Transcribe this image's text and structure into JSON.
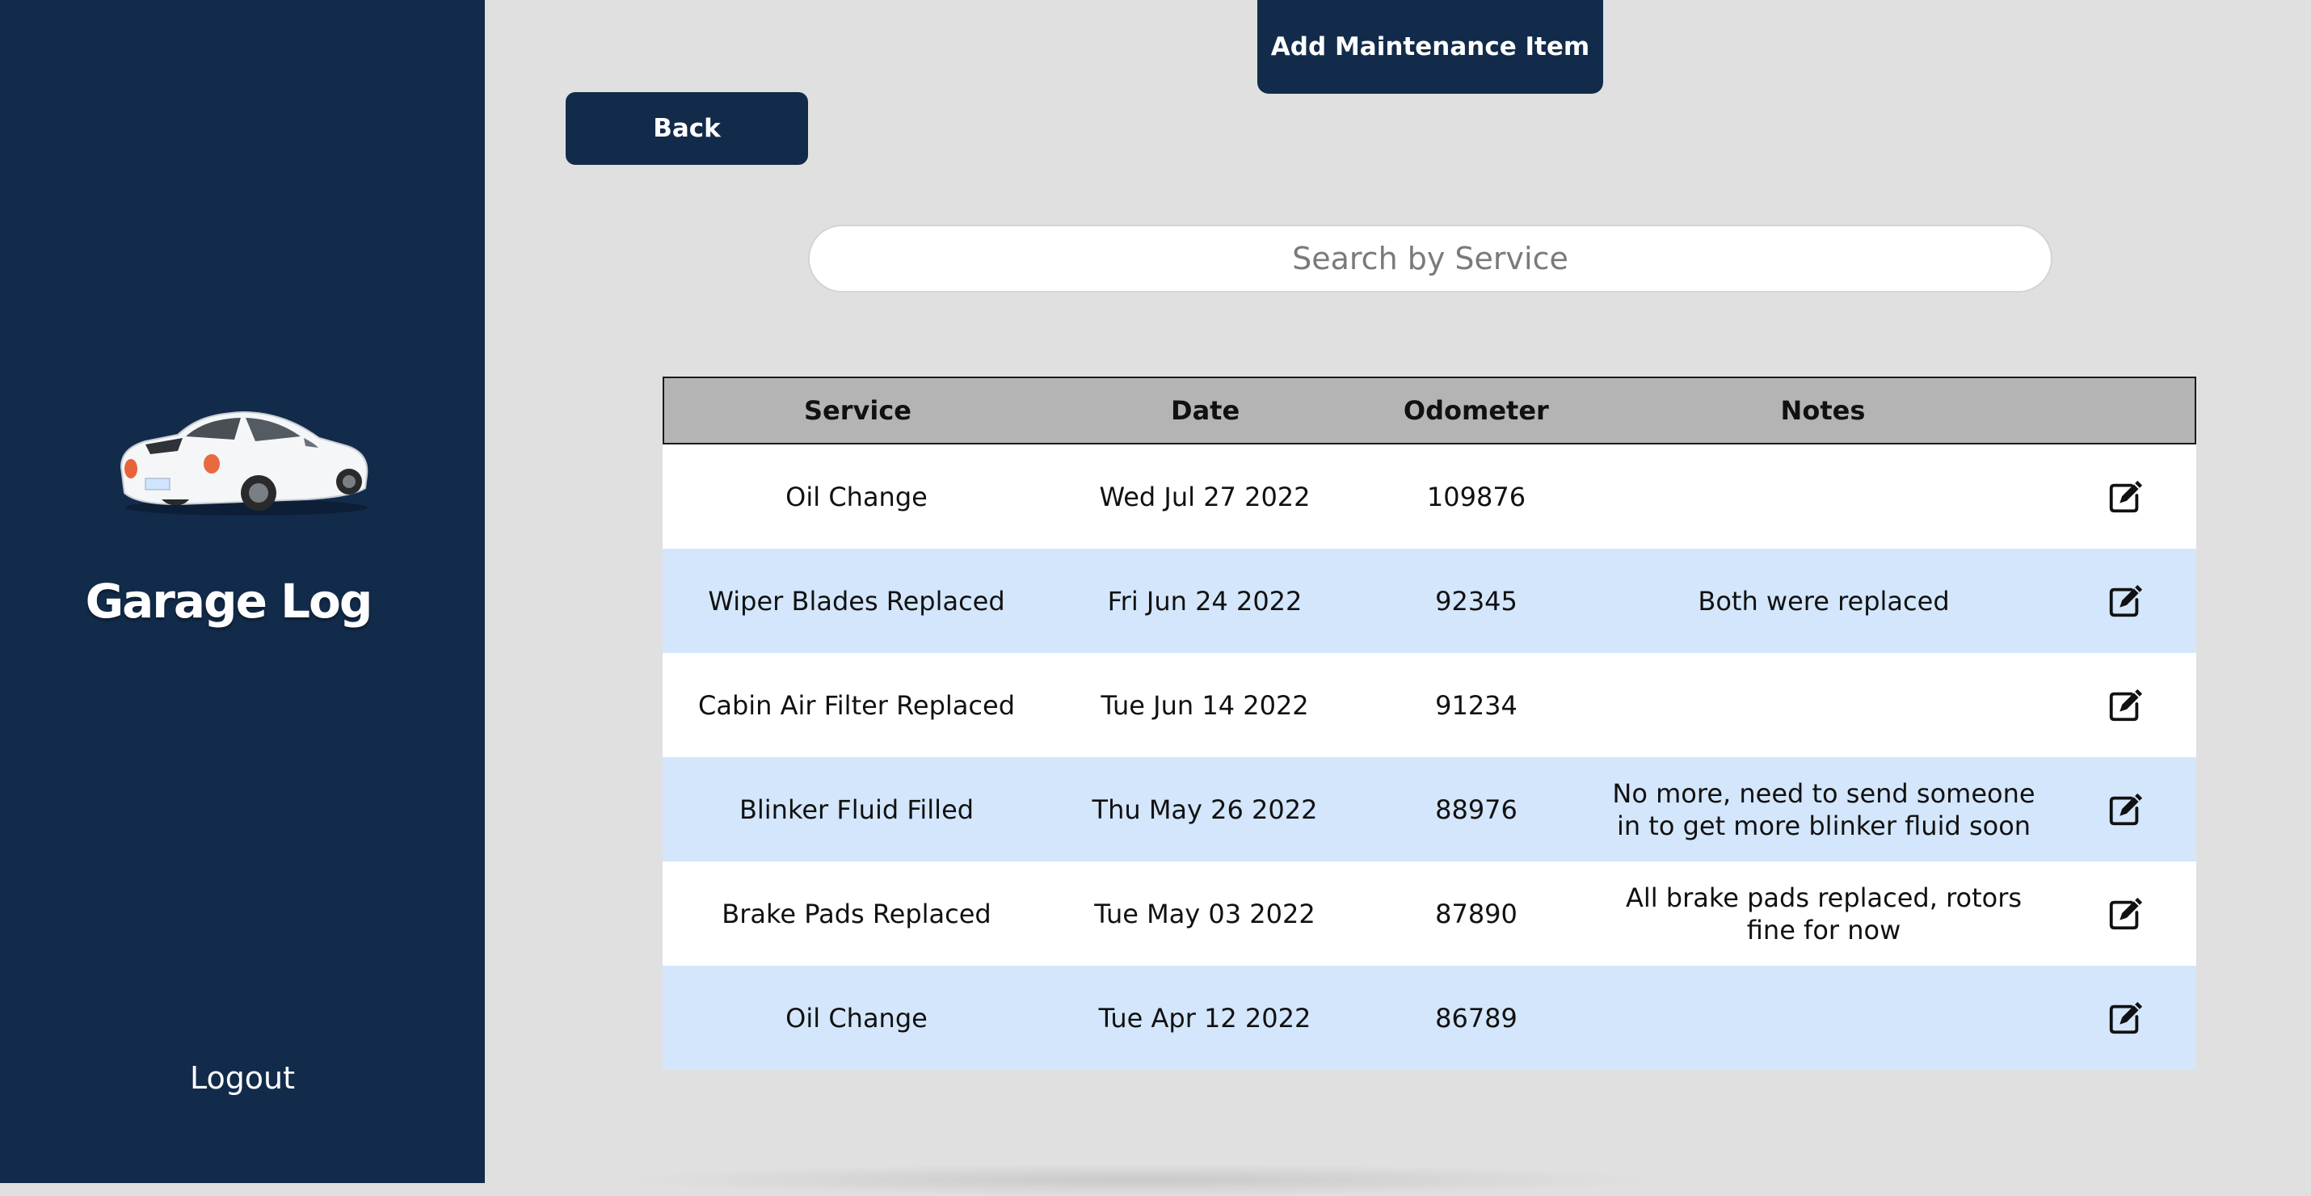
{
  "app": {
    "title": "Garage Log"
  },
  "sidebar": {
    "logo_icon": "car-icon",
    "brand": "Garage Log",
    "logout_label": "Logout"
  },
  "toolbar": {
    "add_label": "Add Maintenance Item",
    "back_label": "Back"
  },
  "search": {
    "placeholder": "Search by Service",
    "value": ""
  },
  "table": {
    "columns": [
      "Service",
      "Date",
      "Odometer",
      "Notes",
      ""
    ],
    "rows": [
      {
        "service": "Oil Change",
        "date": "Wed Jul 27 2022",
        "odometer": "109876",
        "notes": ""
      },
      {
        "service": "Wiper Blades Replaced",
        "date": "Fri Jun 24 2022",
        "odometer": "92345",
        "notes": "Both were replaced"
      },
      {
        "service": "Cabin Air Filter Replaced",
        "date": "Tue Jun 14 2022",
        "odometer": "91234",
        "notes": ""
      },
      {
        "service": "Blinker Fluid Filled",
        "date": "Thu May 26 2022",
        "odometer": "88976",
        "notes": "No more, need to send someone in to get more blinker fluid soon"
      },
      {
        "service": "Brake Pads Replaced",
        "date": "Tue May 03 2022",
        "odometer": "87890",
        "notes": "All brake pads replaced, rotors fine for now"
      },
      {
        "service": "Oil Change",
        "date": "Tue Apr 12 2022",
        "odometer": "86789",
        "notes": ""
      }
    ],
    "edit_icon": "edit-icon"
  },
  "colors": {
    "sidebar_bg": "#122b4a",
    "button_bg": "#122b4a",
    "page_bg": "#e0e0e0",
    "header_bg": "#b4b4b4",
    "row_alt_bg": "#d3e6fb"
  }
}
